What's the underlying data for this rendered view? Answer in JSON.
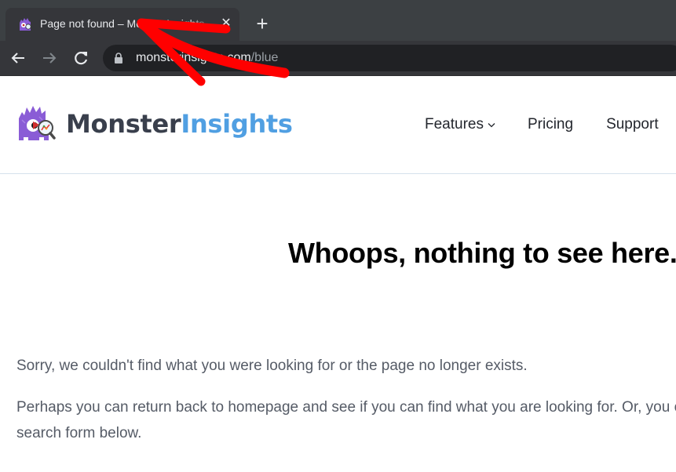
{
  "browser": {
    "tab": {
      "title": "Page not found – MonsterInsights",
      "favicon": "monster-icon",
      "close_icon": "close-icon"
    },
    "new_tab_icon": "plus-icon",
    "toolbar": {
      "back_icon": "arrow-left-icon",
      "forward_icon": "arrow-right-icon",
      "reload_icon": "reload-icon"
    },
    "address_bar": {
      "lock_icon": "lock-icon",
      "host": "monsterinsights.com",
      "path": "/blue"
    }
  },
  "site": {
    "logo": {
      "text_primary": "Monster",
      "text_secondary": "Insights",
      "primary_color": "#393f4c",
      "secondary_color": "#509fe2",
      "mark_color": "#8a5cd6"
    },
    "nav": [
      {
        "label": "Features",
        "has_dropdown": true
      },
      {
        "label": "Pricing"
      },
      {
        "label": "Support"
      }
    ]
  },
  "content": {
    "headline": "Whoops, nothing to see here.",
    "paragraph1": "Sorry, we couldn't find what you were looking for or the page no longer exists.",
    "paragraph2_line1": "Perhaps you can return back to homepage and see if you can find what you are looking for. Or, you can try the",
    "paragraph2_line2": "search form below."
  },
  "annotation": {
    "type": "hand-drawn-arrow",
    "color": "#ff0000",
    "points_to": "tab-title"
  }
}
